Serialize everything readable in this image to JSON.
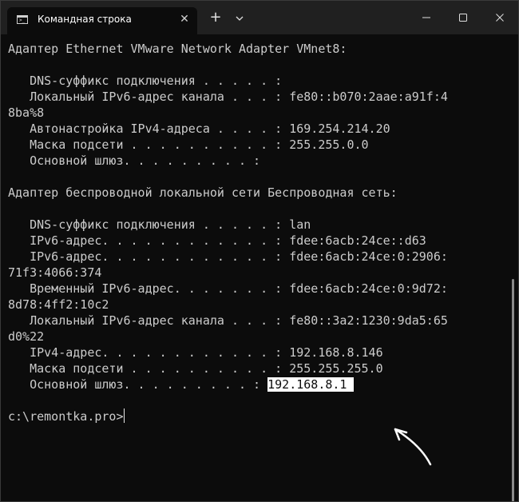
{
  "window": {
    "tab_title": "Командная строка",
    "tab_icon": "cmd-icon",
    "buttons": {
      "close_tab": "✕",
      "new_tab": "+",
      "dropdown_icon": "chevron-down-icon",
      "minimize_icon": "minimize-icon",
      "maximize_icon": "maximize-icon",
      "close_icon": "close-icon"
    }
  },
  "terminal": {
    "lines": [
      "Адаптер Ethernet VMware Network Adapter VMnet8:",
      "",
      "   DNS-суффикс подключения . . . . . :",
      "   Локальный IPv6-адрес канала . . . : fe80::b070:2aae:a91f:4",
      "8ba%8",
      "   Автонастройка IPv4-адреса . . . . : 169.254.214.20",
      "   Маска подсети . . . . . . . . . . : 255.255.0.0",
      "   Основной шлюз. . . . . . . . . :",
      "",
      "Адаптер беспроводной локальной сети Беспроводная сеть:",
      "",
      "   DNS-суффикс подключения . . . . . : lan",
      "   IPv6-адрес. . . . . . . . . . . . : fdee:6acb:24ce::d63",
      "   IPv6-адрес. . . . . . . . . . . . : fdee:6acb:24ce:0:2906:",
      "71f3:4066:374",
      "   Временный IPv6-адрес. . . . . . . : fdee:6acb:24ce:0:9d72:",
      "8d78:4ff2:10c2",
      "   Локальный IPv6-адрес канала . . . : fe80::3a2:1230:9da5:65",
      "d0%22",
      "   IPv4-адрес. . . . . . . . . . . . : 192.168.8.146",
      "   Маска подсети . . . . . . . . . . : 255.255.255.0"
    ],
    "gateway_label": "   Основной шлюз. . . . . . . . . : ",
    "gateway_value": "192.168.8.1 ",
    "prompt": "c:\\remontka.pro>"
  },
  "colors": {
    "background": "#0c0c0c",
    "titlebar": "#202020",
    "text": "#cccccc",
    "highlight_bg": "#ffffff",
    "annotation_arrow": "#ffffff"
  }
}
